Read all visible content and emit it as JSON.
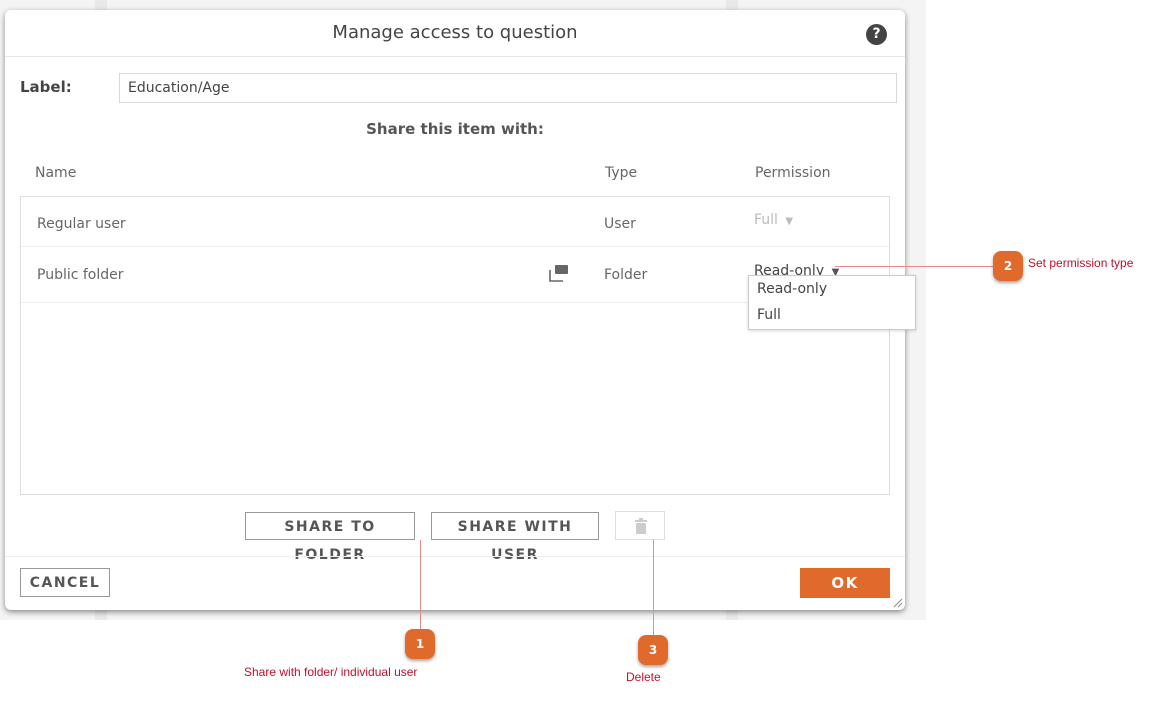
{
  "dialog": {
    "title": "Manage access to question",
    "help_icon": "?",
    "label_caption": "Label:",
    "label_value": "Education/Age",
    "share_heading": "Share this item with:",
    "columns": {
      "name": "Name",
      "type": "Type",
      "permission": "Permission"
    },
    "rows": [
      {
        "name": "Regular user",
        "type": "User",
        "permission": "Full",
        "permission_enabled": false,
        "has_folder_icon": false
      },
      {
        "name": "Public folder",
        "type": "Folder",
        "permission": "Read-only",
        "permission_enabled": true,
        "has_folder_icon": true
      }
    ],
    "dropdown_options": [
      "Read-only",
      "Full"
    ],
    "buttons": {
      "share_folder": "SHARE TO FOLDER",
      "share_user": "SHARE WITH USER",
      "cancel": "CANCEL",
      "ok": "OK"
    },
    "icons": {
      "dropdown_arrow": "▼",
      "help": "help-icon",
      "folder": "shared-folder-icon",
      "trash": "trash-icon"
    }
  },
  "annotations": [
    {
      "number": "1",
      "text": "Share with folder/ individual user"
    },
    {
      "number": "2",
      "text": "Set permission type"
    },
    {
      "number": "3",
      "text": "Delete"
    }
  ],
  "colors": {
    "accent": "#e06a2c",
    "annotation_text": "#c0102a",
    "annotation_line": "#e88a8a"
  }
}
